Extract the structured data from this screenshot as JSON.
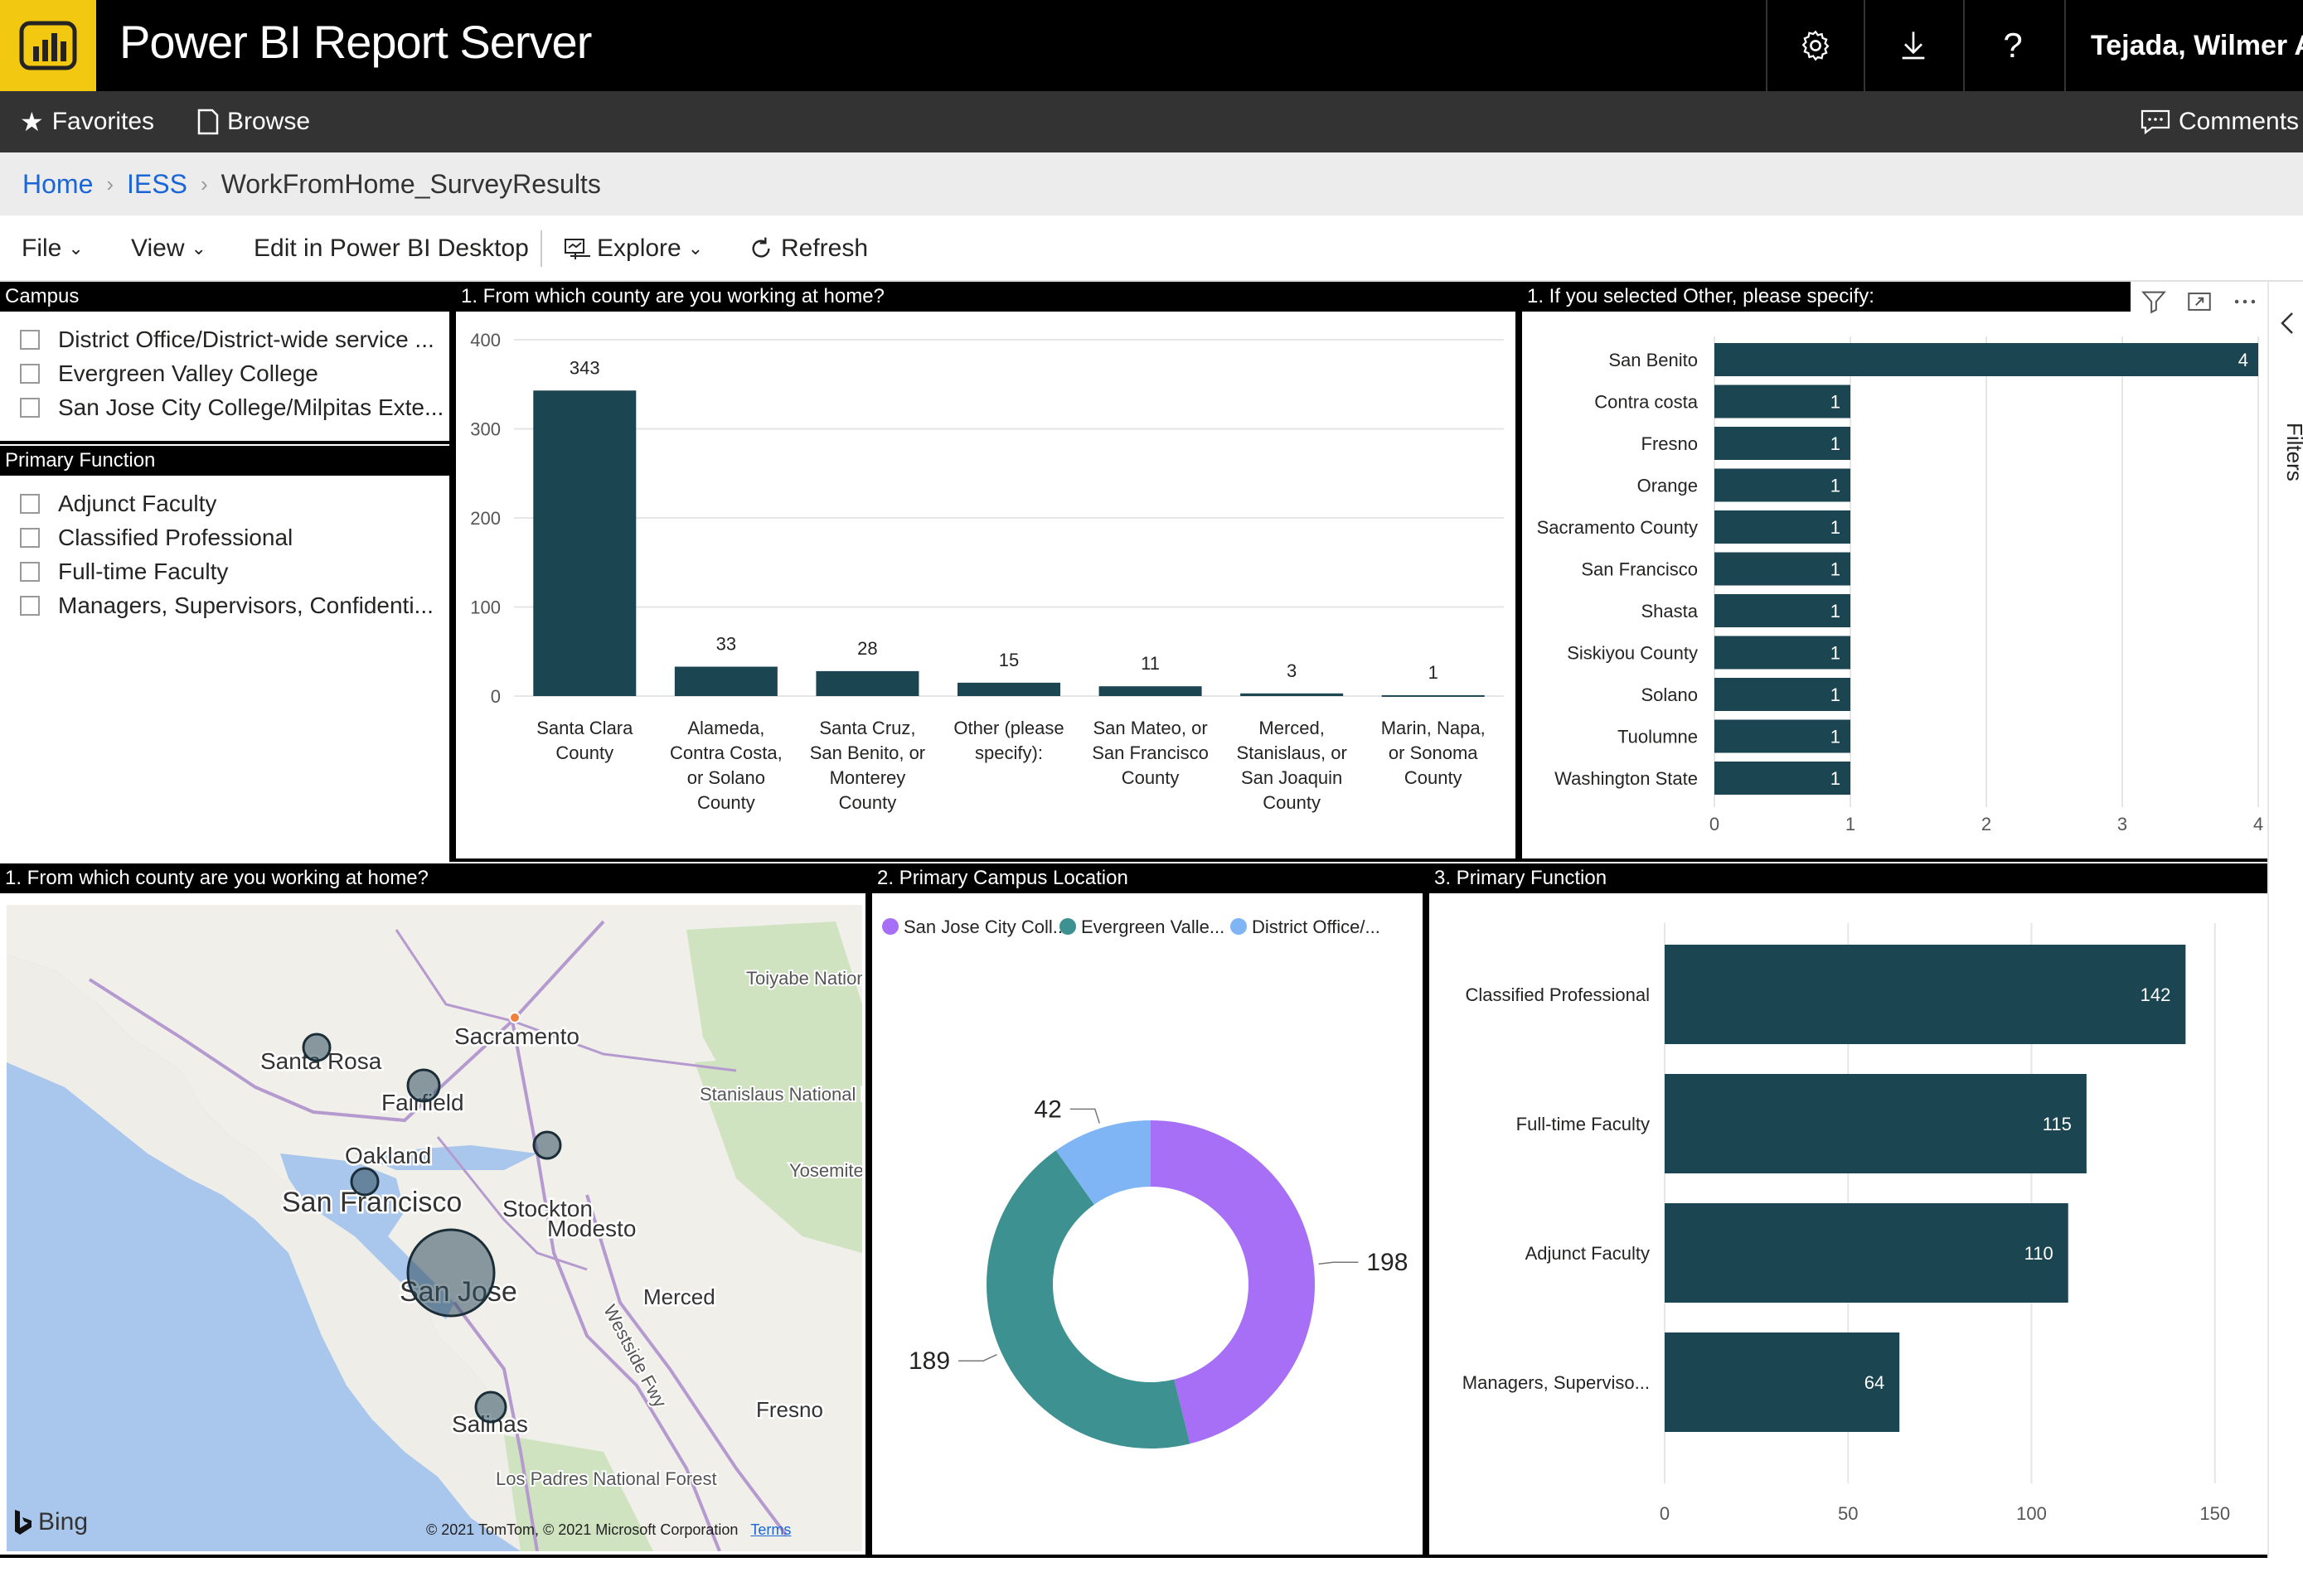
{
  "app": {
    "title": "Power BI Report Server",
    "user": "Tejada, Wilmer A.",
    "logo_icon": "power-bi-logo-icon",
    "colors": {
      "logo_bg": "#f2c811",
      "topbar": "#000000",
      "navbar": "#333333",
      "bar": "#1b4551",
      "link": "#1a66d6"
    }
  },
  "topbar": {
    "settings_icon": "gear-icon",
    "download_icon": "download-icon",
    "help_label": "?"
  },
  "nav": {
    "favorites": "Favorites",
    "browse": "Browse",
    "comments": "Comments"
  },
  "breadcrumb": {
    "home": "Home",
    "folder": "IESS",
    "report": "WorkFromHome_SurveyResults"
  },
  "commands": {
    "file": "File",
    "view": "View",
    "edit": "Edit in Power BI Desktop",
    "explore": "Explore",
    "refresh": "Refresh"
  },
  "slicers": {
    "campus": {
      "title": "Campus",
      "items": [
        "District Office/District-wide service ...",
        "Evergreen Valley College",
        "San Jose City College/Milpitas Exte..."
      ]
    },
    "function": {
      "title": "Primary Function",
      "items": [
        "Adjunct Faculty",
        "Classified Professional",
        "Full-time Faculty",
        "Managers, Supervisors, Confidenti..."
      ]
    }
  },
  "filters_label": "Filters",
  "map": {
    "title": "1. From which county are you working at home?",
    "bing_label": "Bing",
    "copyright": "© 2021 TomTom, © 2021 Microsoft Corporation",
    "terms": "Terms",
    "labels": [
      "Sacramento",
      "Santa Rosa",
      "Fairfield",
      "Oakland",
      "Stockton",
      "San Francisco",
      "Modesto",
      "San Jose",
      "Merced",
      "Salinas",
      "Fresno",
      "Toiyabe National Forest",
      "Stanislaus National Forest",
      "Yosemite N.P.",
      "Los Padres National Forest",
      "Westside Fwy"
    ]
  },
  "chart_data": [
    {
      "type": "bar",
      "title": "1. From which county are you working at home?",
      "categories": [
        "Santa Clara County",
        "Alameda, Contra Costa, or Solano County",
        "Santa Cruz, San Benito, or Monterey County",
        "Other (please specify):",
        "San Mateo, or San Francisco County",
        "Merced, Stanislaus, or San Joaquin County",
        "Marin, Napa, or Sonoma County"
      ],
      "category_lines": [
        [
          "Santa Clara",
          "County"
        ],
        [
          "Alameda,",
          "Contra Costa,",
          "or Solano",
          "County"
        ],
        [
          "Santa Cruz,",
          "San Benito, or",
          "Monterey",
          "County"
        ],
        [
          "Other (please",
          "specify):"
        ],
        [
          "San Mateo, or",
          "San Francisco",
          "County"
        ],
        [
          "Merced,",
          "Stanislaus, or",
          "San Joaquin",
          "County"
        ],
        [
          "Marin, Napa,",
          "or Sonoma",
          "County"
        ]
      ],
      "values": [
        343,
        33,
        28,
        15,
        11,
        3,
        1
      ],
      "ylim": [
        0,
        400
      ],
      "yticks": [
        0,
        100,
        200,
        300,
        400
      ],
      "grid": true
    },
    {
      "type": "bar",
      "orientation": "horizontal",
      "title": "1. If you selected Other, please specify:",
      "categories": [
        "San Benito",
        "Contra costa",
        "Fresno",
        "Orange",
        "Sacramento County",
        "San Francisco",
        "Shasta",
        "Siskiyou County",
        "Solano",
        "Tuolumne",
        "Washington State"
      ],
      "values": [
        4,
        1,
        1,
        1,
        1,
        1,
        1,
        1,
        1,
        1,
        1
      ],
      "xlim": [
        0,
        4
      ],
      "xticks": [
        0,
        1,
        2,
        3,
        4
      ],
      "grid": true
    },
    {
      "type": "pie",
      "donut": true,
      "title": "2. Primary Campus Location",
      "legend": [
        "San Jose City Coll...",
        "Evergreen Valle...",
        "District Office/..."
      ],
      "categories": [
        "San Jose City College",
        "Evergreen Valley College",
        "District Office"
      ],
      "values": [
        198,
        189,
        42
      ],
      "colors": [
        "#a66ff5",
        "#3d9190",
        "#7fb5f5"
      ],
      "legend_position": "top"
    },
    {
      "type": "bar",
      "orientation": "horizontal",
      "title": "3. Primary Function",
      "categories": [
        "Classified Professional",
        "Full-time Faculty",
        "Adjunct Faculty",
        "Managers, Superviso..."
      ],
      "values": [
        142,
        115,
        110,
        64
      ],
      "xlim": [
        0,
        160
      ],
      "xticks": [
        0,
        50,
        100,
        150
      ],
      "grid": true
    }
  ]
}
